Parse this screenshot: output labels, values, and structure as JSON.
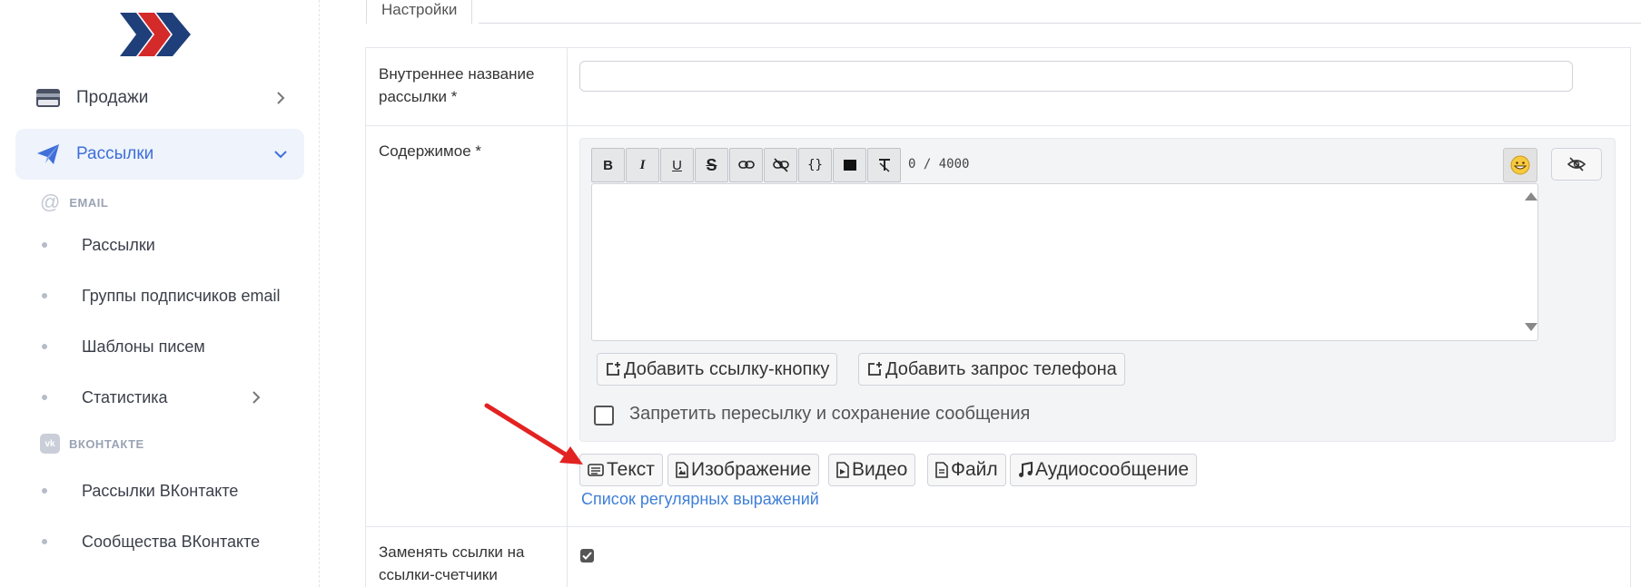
{
  "sidebar": {
    "logo_name": "brand-logo",
    "items": [
      {
        "label": "Продажи",
        "icon": "card-icon",
        "expanded": false
      },
      {
        "label": "Рассылки",
        "icon": "paper-plane-icon",
        "expanded": true
      }
    ],
    "sections": [
      {
        "title": "EMAIL",
        "icon": "at-icon",
        "items": [
          {
            "label": "Рассылки"
          },
          {
            "label": "Группы подписчиков email"
          },
          {
            "label": "Шаблоны писем"
          },
          {
            "label": "Статистика",
            "has_submenu": true
          }
        ]
      },
      {
        "title": "ВКОНТАКТЕ",
        "icon": "vk-icon",
        "items": [
          {
            "label": "Рассылки ВКонтакте"
          },
          {
            "label": "Сообщества ВКонтакте"
          }
        ]
      }
    ],
    "accent_color": "#3f6fd8"
  },
  "main": {
    "tab_label": "Настройки",
    "form": {
      "name_label": "Внутреннее название рассылки *",
      "name_value": "",
      "content_label": "Содержимое *",
      "replace_links_label": "Заменять ссылки на ссылки-счетчики",
      "replace_links_checked": true
    },
    "editor": {
      "toolbar": [
        {
          "name": "bold-button",
          "glyph": "B"
        },
        {
          "name": "italic-button",
          "glyph": "I"
        },
        {
          "name": "underline-button",
          "glyph": "U"
        },
        {
          "name": "strikethrough-button",
          "glyph": "S"
        },
        {
          "name": "link-button",
          "glyph": "link"
        },
        {
          "name": "unlink-button",
          "glyph": "unlink"
        },
        {
          "name": "code-button",
          "glyph": "{}"
        },
        {
          "name": "spoiler-button",
          "glyph": "block"
        },
        {
          "name": "clear-format-button",
          "glyph": "clear"
        }
      ],
      "counter": "0 / 4000",
      "emoji_icon": "smile-emoji-icon",
      "preview_icon": "eye-off-icon",
      "text": ""
    },
    "add_link_button": "Добавить ссылку-кнопку",
    "add_phone_button": "Добавить запрос телефона",
    "forbid_forward_label": "Запретить пересылку и сохранение сообщения",
    "forbid_forward_checked": false,
    "message_types": [
      {
        "label": "Текст",
        "icon": "text-icon"
      },
      {
        "label": "Изображение",
        "icon": "image-file-icon"
      },
      {
        "label": "Видео",
        "icon": "video-file-icon"
      },
      {
        "label": "Файл",
        "icon": "file-icon"
      },
      {
        "label": "Аудиосообщение",
        "icon": "music-note-icon"
      }
    ],
    "regex_link": "Список регулярных выражений",
    "annotation_arrow_color": "#e32222"
  }
}
